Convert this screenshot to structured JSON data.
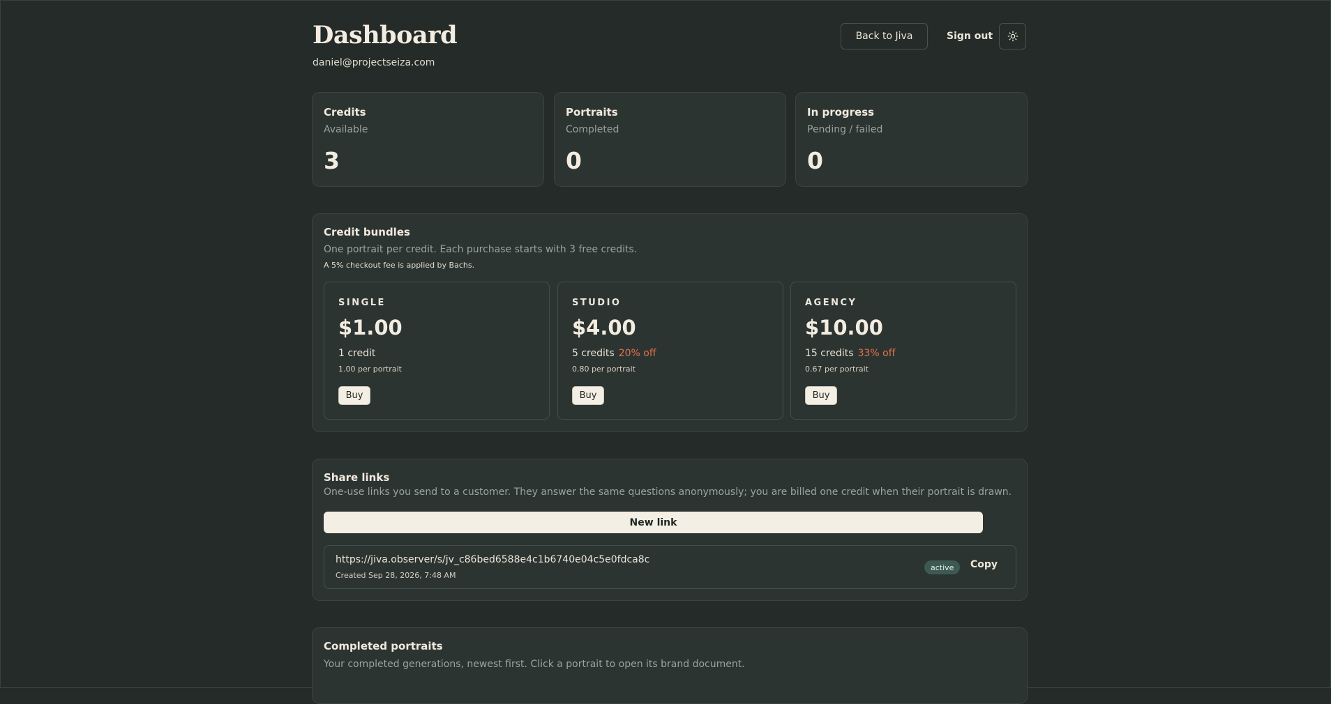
{
  "header": {
    "title": "Dashboard",
    "email": "daniel@projectseiza.com",
    "back_label": "Back to Jiva",
    "signout_label": "Sign out",
    "theme_icon": "sun-icon"
  },
  "stats": [
    {
      "label": "Credits",
      "sub": "Available",
      "value": "3"
    },
    {
      "label": "Portraits",
      "sub": "Completed",
      "value": "0"
    },
    {
      "label": "In progress",
      "sub": "Pending / failed",
      "value": "0"
    }
  ],
  "bundles_section": {
    "title": "Credit bundles",
    "desc": "One portrait per credit. Each purchase starts with 3 free credits.",
    "note": "A 5% checkout fee is applied by Bachs.",
    "bundles": [
      {
        "name": "SINGLE",
        "price": "$1.00",
        "credits": "1 credit",
        "discount": "",
        "per": "1.00 per portrait",
        "buy": "Buy"
      },
      {
        "name": "STUDIO",
        "price": "$4.00",
        "credits": "5 credits",
        "discount": "20% off",
        "per": "0.80 per portrait",
        "buy": "Buy"
      },
      {
        "name": "AGENCY",
        "price": "$10.00",
        "credits": "15 credits",
        "discount": "33% off",
        "per": "0.67 per portrait",
        "buy": "Buy"
      }
    ]
  },
  "share_section": {
    "title": "Share links",
    "desc": "One-use links you send to a customer. They answer the same questions anonymously; you are billed one credit when their portrait is drawn.",
    "new_link_label": "New link",
    "links": [
      {
        "url": "https://jiva.observer/s/jv_c86bed6588e4c1b6740e04c5e0fdca8c",
        "created": "Created Sep 28, 2026, 7:48 AM",
        "status": "active",
        "copy_label": "Copy"
      }
    ]
  },
  "completed_section": {
    "title": "Completed portraits",
    "desc": "Your completed generations, newest first. Click a portrait to open its brand document."
  },
  "colors": {
    "background": "#242b28",
    "card": "#2c3431",
    "accent_discount": "#e4704f",
    "badge_active": "#3c5a52",
    "button_light": "#f4efe4"
  }
}
